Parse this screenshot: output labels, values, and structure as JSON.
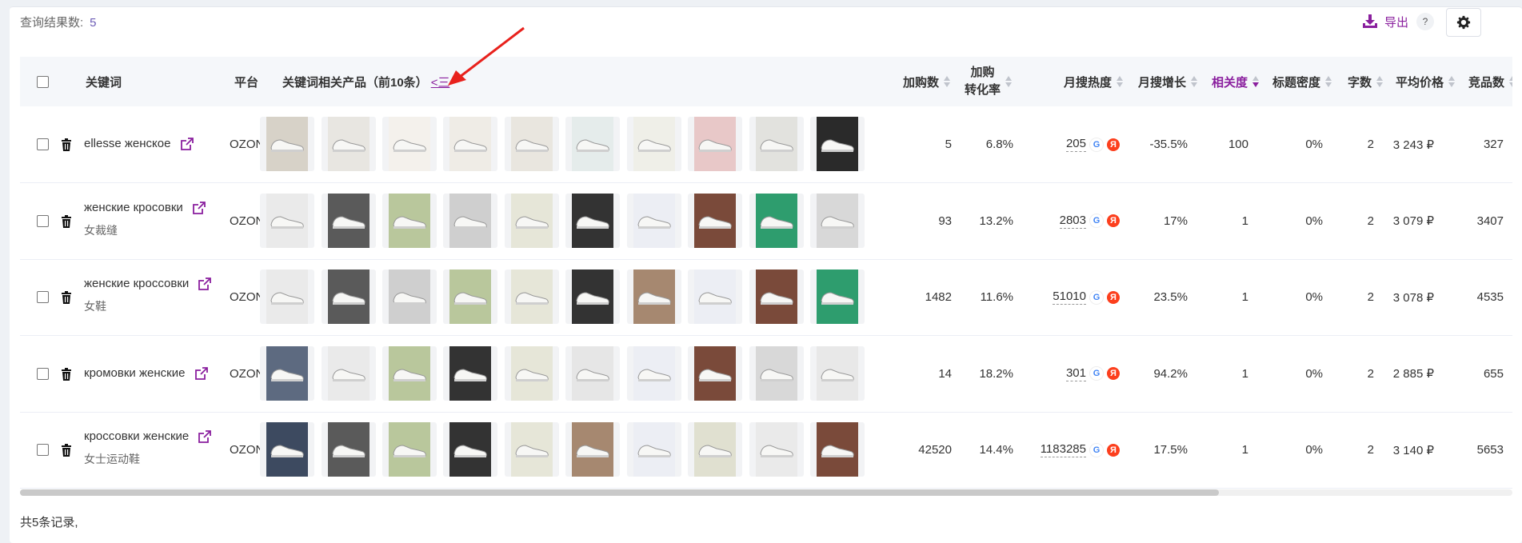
{
  "summary": {
    "label": "查询结果数:",
    "count": "5"
  },
  "toolbar": {
    "export_label": "导出",
    "help_label": "?"
  },
  "colors": {
    "accent": "#8a1f9e",
    "annotation_arrow": "#e8211c"
  },
  "table": {
    "headers": {
      "keyword": "关键词",
      "platform": "平台",
      "products": "关键词相关产品（前10条）",
      "collapse_toggle": "<三",
      "cart_adds": "加购数",
      "cart_rate_1": "加购",
      "cart_rate_2": "转化率",
      "monthly_search": "月搜热度",
      "monthly_growth": "月搜增长",
      "relevance": "相关度",
      "title_density": "标题密度",
      "char_count": "字数",
      "avg_price": "平均价格",
      "competitors": "竞品数"
    },
    "rows": [
      {
        "keyword": "ellesse женское",
        "translation": "",
        "platform": "OZON",
        "cart_adds": "5",
        "cart_rate": "6.8%",
        "monthly_search": "205",
        "growth": "-35.5%",
        "relevance": "100",
        "density": "0%",
        "chars": "2",
        "price": "3 243 ₽",
        "competitors": "327"
      },
      {
        "keyword": "женские кросовки",
        "translation": "女裁缝",
        "platform": "OZON",
        "cart_adds": "93",
        "cart_rate": "13.2%",
        "monthly_search": "2803",
        "growth": "17%",
        "relevance": "1",
        "density": "0%",
        "chars": "2",
        "price": "3 079 ₽",
        "competitors": "3407"
      },
      {
        "keyword": "женские кроссовки",
        "translation": "女鞋",
        "platform": "OZON",
        "cart_adds": "1482",
        "cart_rate": "11.6%",
        "monthly_search": "51010",
        "growth": "23.5%",
        "relevance": "1",
        "density": "0%",
        "chars": "2",
        "price": "3 078 ₽",
        "competitors": "4535"
      },
      {
        "keyword": "кромовки женские",
        "translation": "",
        "platform": "OZON",
        "cart_adds": "14",
        "cart_rate": "18.2%",
        "monthly_search": "301",
        "growth": "94.2%",
        "relevance": "1",
        "density": "0%",
        "chars": "2",
        "price": "2 885 ₽",
        "competitors": "655"
      },
      {
        "keyword": "кроссовки женские",
        "translation": "女士运动鞋",
        "platform": "OZON",
        "cart_adds": "42520",
        "cart_rate": "14.4%",
        "monthly_search": "1183285",
        "growth": "17.5%",
        "relevance": "1",
        "density": "0%",
        "chars": "2",
        "price": "3 140 ₽",
        "competitors": "5653"
      }
    ]
  },
  "icons": {
    "google": "G",
    "yandex": "Я"
  },
  "footer": {
    "total_label": "共5条记录,"
  }
}
